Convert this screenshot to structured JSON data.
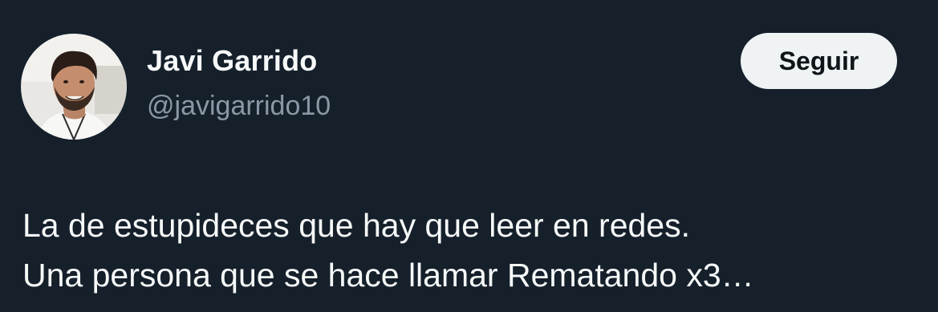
{
  "author": {
    "display_name": "Javi Garrido",
    "handle": "@javigarrido10",
    "avatar_icon": "profile-photo"
  },
  "follow_button": {
    "label": "Seguir"
  },
  "tweet": {
    "lines": [
      "La de estupideces que hay que leer en redes.",
      "Una persona que se hace llamar Rematando x3…"
    ]
  },
  "colors": {
    "background": "#15202b",
    "primary_text": "#f7f9f9",
    "secondary_text": "#8b98a5",
    "button_bg": "#eff3f4",
    "button_text": "#0f1419"
  }
}
